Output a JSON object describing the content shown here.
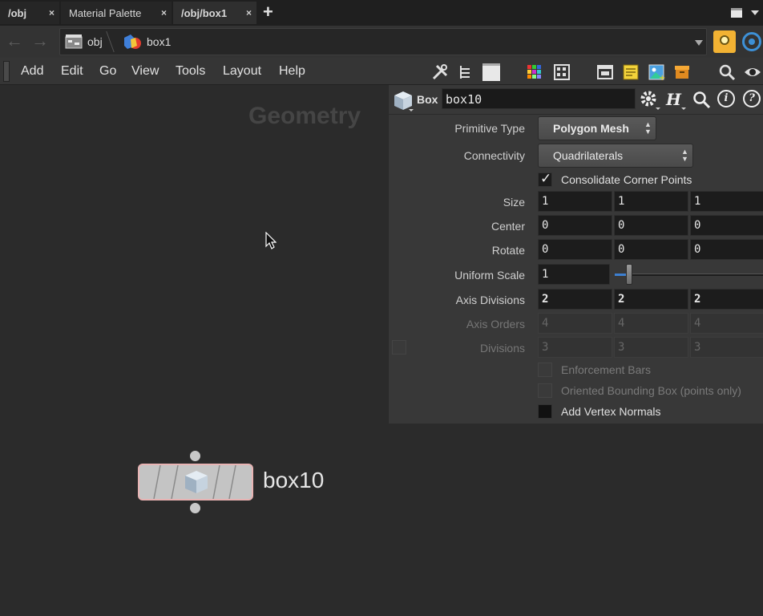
{
  "tabs": [
    {
      "label": "/obj",
      "close": "×"
    },
    {
      "label": "Material Palette",
      "close": "×"
    },
    {
      "label": "/obj/box1",
      "close": "×"
    }
  ],
  "add_tab": "+",
  "path": {
    "crumbs": [
      "obj",
      "box1"
    ]
  },
  "menu": [
    "Add",
    "Edit",
    "Go",
    "View",
    "Tools",
    "Layout",
    "Help"
  ],
  "network": {
    "context_label": "Geometry",
    "node_name": "box10"
  },
  "params": {
    "node_type": "Box",
    "node_name": "box10",
    "primitive_type": {
      "label": "Primitive Type",
      "value": "Polygon Mesh"
    },
    "connectivity": {
      "label": "Connectivity",
      "value": "Quadrilaterals"
    },
    "consolidate": {
      "label": "Consolidate Corner Points",
      "checked": true
    },
    "size": {
      "label": "Size",
      "values": [
        "1",
        "1",
        "1"
      ]
    },
    "center": {
      "label": "Center",
      "values": [
        "0",
        "0",
        "0"
      ]
    },
    "rotate": {
      "label": "Rotate",
      "values": [
        "0",
        "0",
        "0"
      ]
    },
    "uniform_scale": {
      "label": "Uniform Scale",
      "value": "1"
    },
    "axis_divisions": {
      "label": "Axis Divisions",
      "values": [
        "2",
        "2",
        "2"
      ]
    },
    "axis_orders": {
      "label": "Axis Orders",
      "values": [
        "4",
        "4",
        "4"
      ]
    },
    "divisions": {
      "label": "Divisions",
      "values": [
        "3",
        "3",
        "3"
      ]
    },
    "enforcement_bars": {
      "label": "Enforcement Bars"
    },
    "oriented_bbox": {
      "label": "Oriented Bounding Box (points only)"
    },
    "vertex_normals": {
      "label": "Add Vertex Normals"
    }
  },
  "colors": {
    "accent": "#f2b233",
    "node_outline": "#e8b4b4"
  }
}
